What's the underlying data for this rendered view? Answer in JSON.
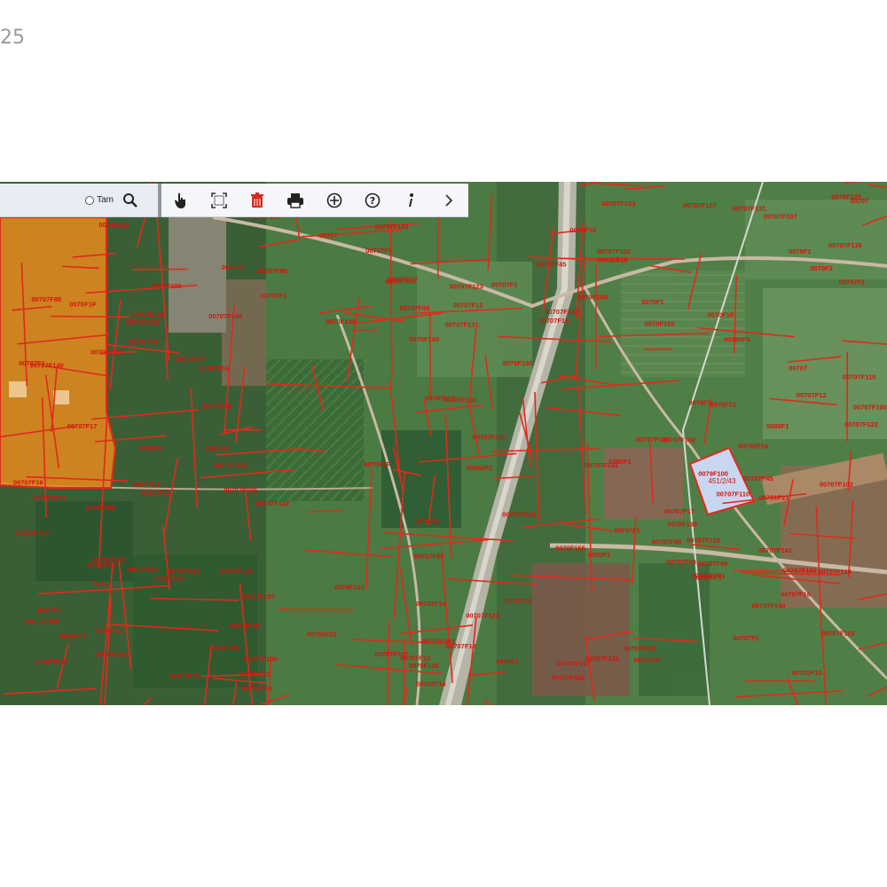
{
  "page": {
    "corner_text": "25"
  },
  "search_panel": {
    "checkbox_label": "Tam"
  },
  "toolbar": {
    "icons": [
      "hand-pointer-icon",
      "extent-icon",
      "delete-icon",
      "print-icon",
      "add-icon",
      "help-icon",
      "info-icon",
      "next-icon"
    ]
  },
  "map": {
    "parcel_border_color": "#e02a1c",
    "label_color": "#d4140c",
    "highlight_fill": "#e88a1c",
    "selected_fill": "#c9d6f0",
    "selected_label": "451/2/43",
    "parcel_labels": [
      "00707F1",
      "00707F123",
      "00707F107",
      "0079F100",
      "00707F110",
      "00707F201",
      "00707F122",
      "00707F105",
      "00707F100",
      "00707F102",
      "00707F131",
      "00707F141",
      "00707F140",
      "0070F130",
      "00707F45",
      "00707F88",
      "00701F21",
      "0070F155",
      "00707F98",
      "00702F10",
      "00702F14",
      "0070F1",
      "00707F1",
      "00080F1",
      "0080F1",
      "00707",
      "00707F12",
      "0070F12",
      "00707F16",
      "00707F17",
      "00707F12",
      "0070F125",
      "0070F1P",
      "0070F2"
    ]
  }
}
